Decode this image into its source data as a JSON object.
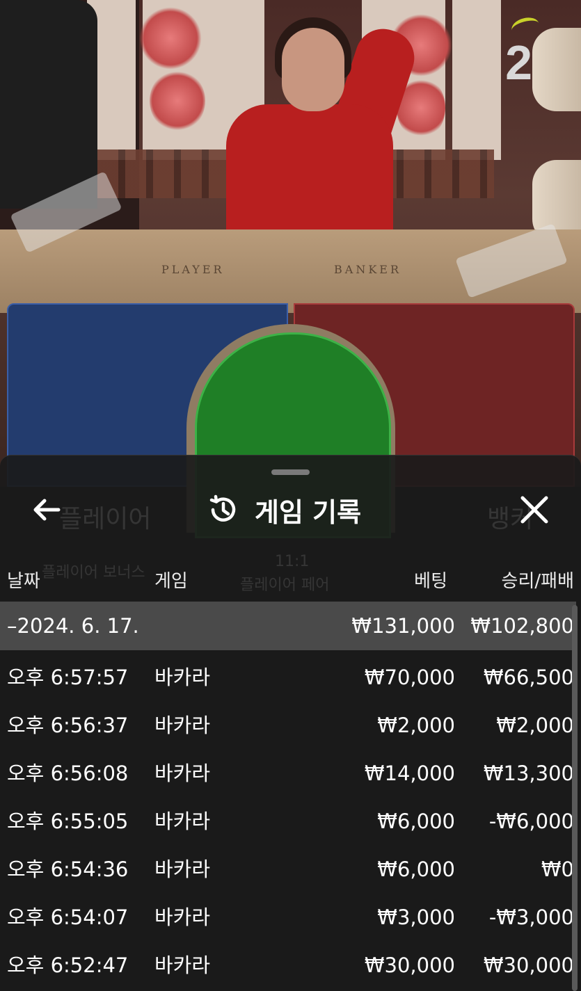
{
  "video": {
    "round_number": "2",
    "table_labels": [
      "PLAYER",
      "BANKER"
    ]
  },
  "history": {
    "title": "게임 기록",
    "back_icon": "arrow-left-icon",
    "history_icon": "history-clock-icon",
    "close_icon": "close-icon",
    "columns": {
      "date": "날짜",
      "game": "게임",
      "bet": "베팅",
      "result": "승리/패배"
    },
    "day_group": {
      "date": "–2024. 6. 17.",
      "total_bet": "₩131,000",
      "total_result": "₩102,800"
    },
    "rows": [
      {
        "time": "오후 6:57:57",
        "game": "바카라",
        "bet": "₩70,000",
        "result": "₩66,500"
      },
      {
        "time": "오후 6:56:37",
        "game": "바카라",
        "bet": "₩2,000",
        "result": "₩2,000"
      },
      {
        "time": "오후 6:56:08",
        "game": "바카라",
        "bet": "₩14,000",
        "result": "₩13,300"
      },
      {
        "time": "오후 6:55:05",
        "game": "바카라",
        "bet": "₩6,000",
        "result": "-₩6,000"
      },
      {
        "time": "오후 6:54:36",
        "game": "바카라",
        "bet": "₩6,000",
        "result": "₩0"
      },
      {
        "time": "오후 6:54:07",
        "game": "바카라",
        "bet": "₩3,000",
        "result": "-₩3,000"
      },
      {
        "time": "오후 6:52:47",
        "game": "바카라",
        "bet": "₩30,000",
        "result": "₩30,000"
      }
    ],
    "background_ghost_text": [
      "플레이어",
      "뱅커",
      "플레이어 보너스",
      "11:1",
      "플레이어 페어"
    ]
  },
  "colors": {
    "player_spot": "#233c6e",
    "banker_spot": "#6e2424",
    "tie_spot": "#1f7f26",
    "sheet_bg": "#1b1b1b",
    "day_row_bg": "#4a4a4a"
  }
}
